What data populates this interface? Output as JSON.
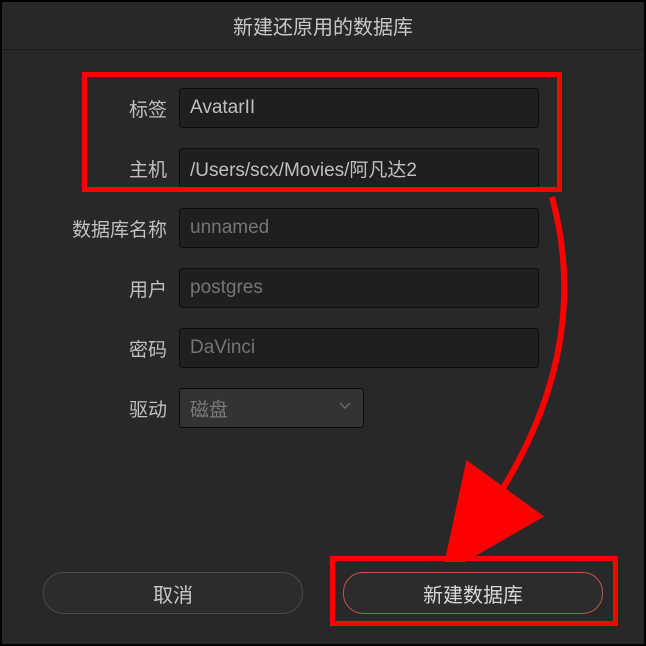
{
  "title": "新建还原用的数据库",
  "form": {
    "label_tag": "标签",
    "value_tag": "AvatarII",
    "label_host": "主机",
    "value_host": "/Users/scx/Movies/阿凡达2",
    "label_dbname": "数据库名称",
    "placeholder_dbname": "unnamed",
    "label_user": "用户",
    "placeholder_user": "postgres",
    "label_password": "密码",
    "placeholder_password": "DaVinci",
    "label_driver": "驱动",
    "driver_value": "磁盘"
  },
  "buttons": {
    "cancel": "取消",
    "create": "新建数据库"
  }
}
